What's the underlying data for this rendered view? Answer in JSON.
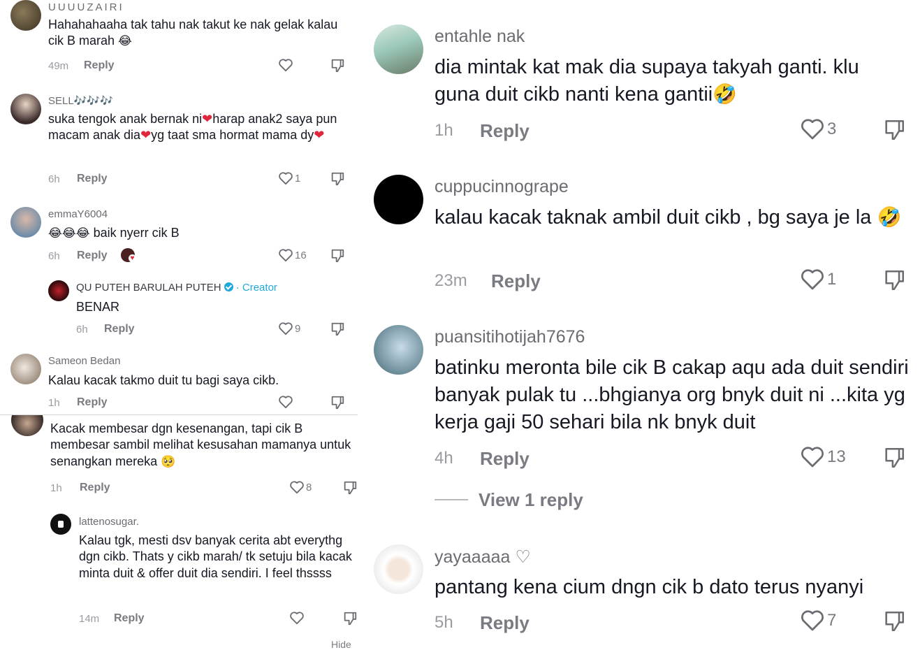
{
  "left_panel": {
    "comments": [
      {
        "username": "UUUUZAIRI",
        "text": "Hahahahaaha tak tahu nak takut ke nak gelak kalau cik B marah",
        "emoji": "😂",
        "time": "49m",
        "reply_label": "Reply",
        "likes": ""
      },
      {
        "username": "SELL🎶🎶🎶",
        "text_parts": [
          "suka tengok anak bernak ni",
          "harap anak2 saya pun macam anak dia",
          "yg taat sma hormat mama dy"
        ],
        "emoji": "❤️",
        "time": "6h",
        "reply_label": "Reply",
        "likes": "1"
      },
      {
        "username": "emmaY6004",
        "text": "baik nyerr cik B",
        "emoji": "😂",
        "time": "6h",
        "reply_label": "Reply",
        "likes": "16"
      },
      {
        "username": "QU PUTEH BARULAH PUTEH",
        "creator_label": "Creator",
        "text": "BENAR",
        "time": "6h",
        "reply_label": "Reply",
        "likes": "9"
      },
      {
        "username": "Sameon Bedan",
        "text": "Kalau kacak takmo duit tu bagi saya cikb.",
        "time": "1h",
        "reply_label": "Reply",
        "likes": ""
      },
      {
        "username": "",
        "text": "Kacak membesar dgn kesenangan, tapi cik B membesar sambil melihat kesusahan mamanya untuk senangkan mereka",
        "emoji": "🥺",
        "time": "1h",
        "reply_label": "Reply",
        "likes": "8"
      },
      {
        "username": "lattenosugar.",
        "text": "Kalau tgk, mesti dsv banyak cerita abt everythg dgn cikb. Thats y cikb marah/ tk setuju bila kacak minta duit & offer duit dia sendiri. I feel thssss",
        "time": "14m",
        "reply_label": "Reply",
        "likes": ""
      }
    ],
    "hide_label": "Hide"
  },
  "right_panel": {
    "comments": [
      {
        "username": "entahle nak",
        "text": "dia mintak kat mak dia supaya takyah ganti. klu guna duit cikb nanti kena gantii",
        "emoji": "🤣",
        "time": "1h",
        "reply_label": "Reply",
        "likes": "3"
      },
      {
        "username": "cuppucinnogrape",
        "text": "kalau kacak taknak ambil duit cikb , bg saya je la",
        "emoji": "🤣",
        "time": "23m",
        "reply_label": "Reply",
        "likes": "1"
      },
      {
        "username": "puansitihotijah7676",
        "text": "batinku meronta bile cik B cakap aqu ada duit sendiri banyak pulak tu ...bhgianya org bnyk duit ni ...kita yg kerja gaji 50 sehari bila nk bnyk duit",
        "time": "4h",
        "reply_label": "Reply",
        "likes": "13",
        "view_replies": "View 1 reply"
      },
      {
        "username": "yayaaaaa ♡",
        "text": "pantang kena cium dngn cik b dato terus nyanyi",
        "time": "5h",
        "reply_label": "Reply",
        "likes": "7"
      }
    ]
  },
  "colors": {
    "text": "#161823",
    "meta": "#9a9ba1",
    "creator": "#20a8d8",
    "heart": "#e0263b"
  },
  "icons": [
    "heart-outline-icon",
    "dislike-icon",
    "verified-badge-icon",
    "emoji-laughing",
    "emoji-red-heart",
    "emoji-rofl",
    "emoji-pleading"
  ]
}
